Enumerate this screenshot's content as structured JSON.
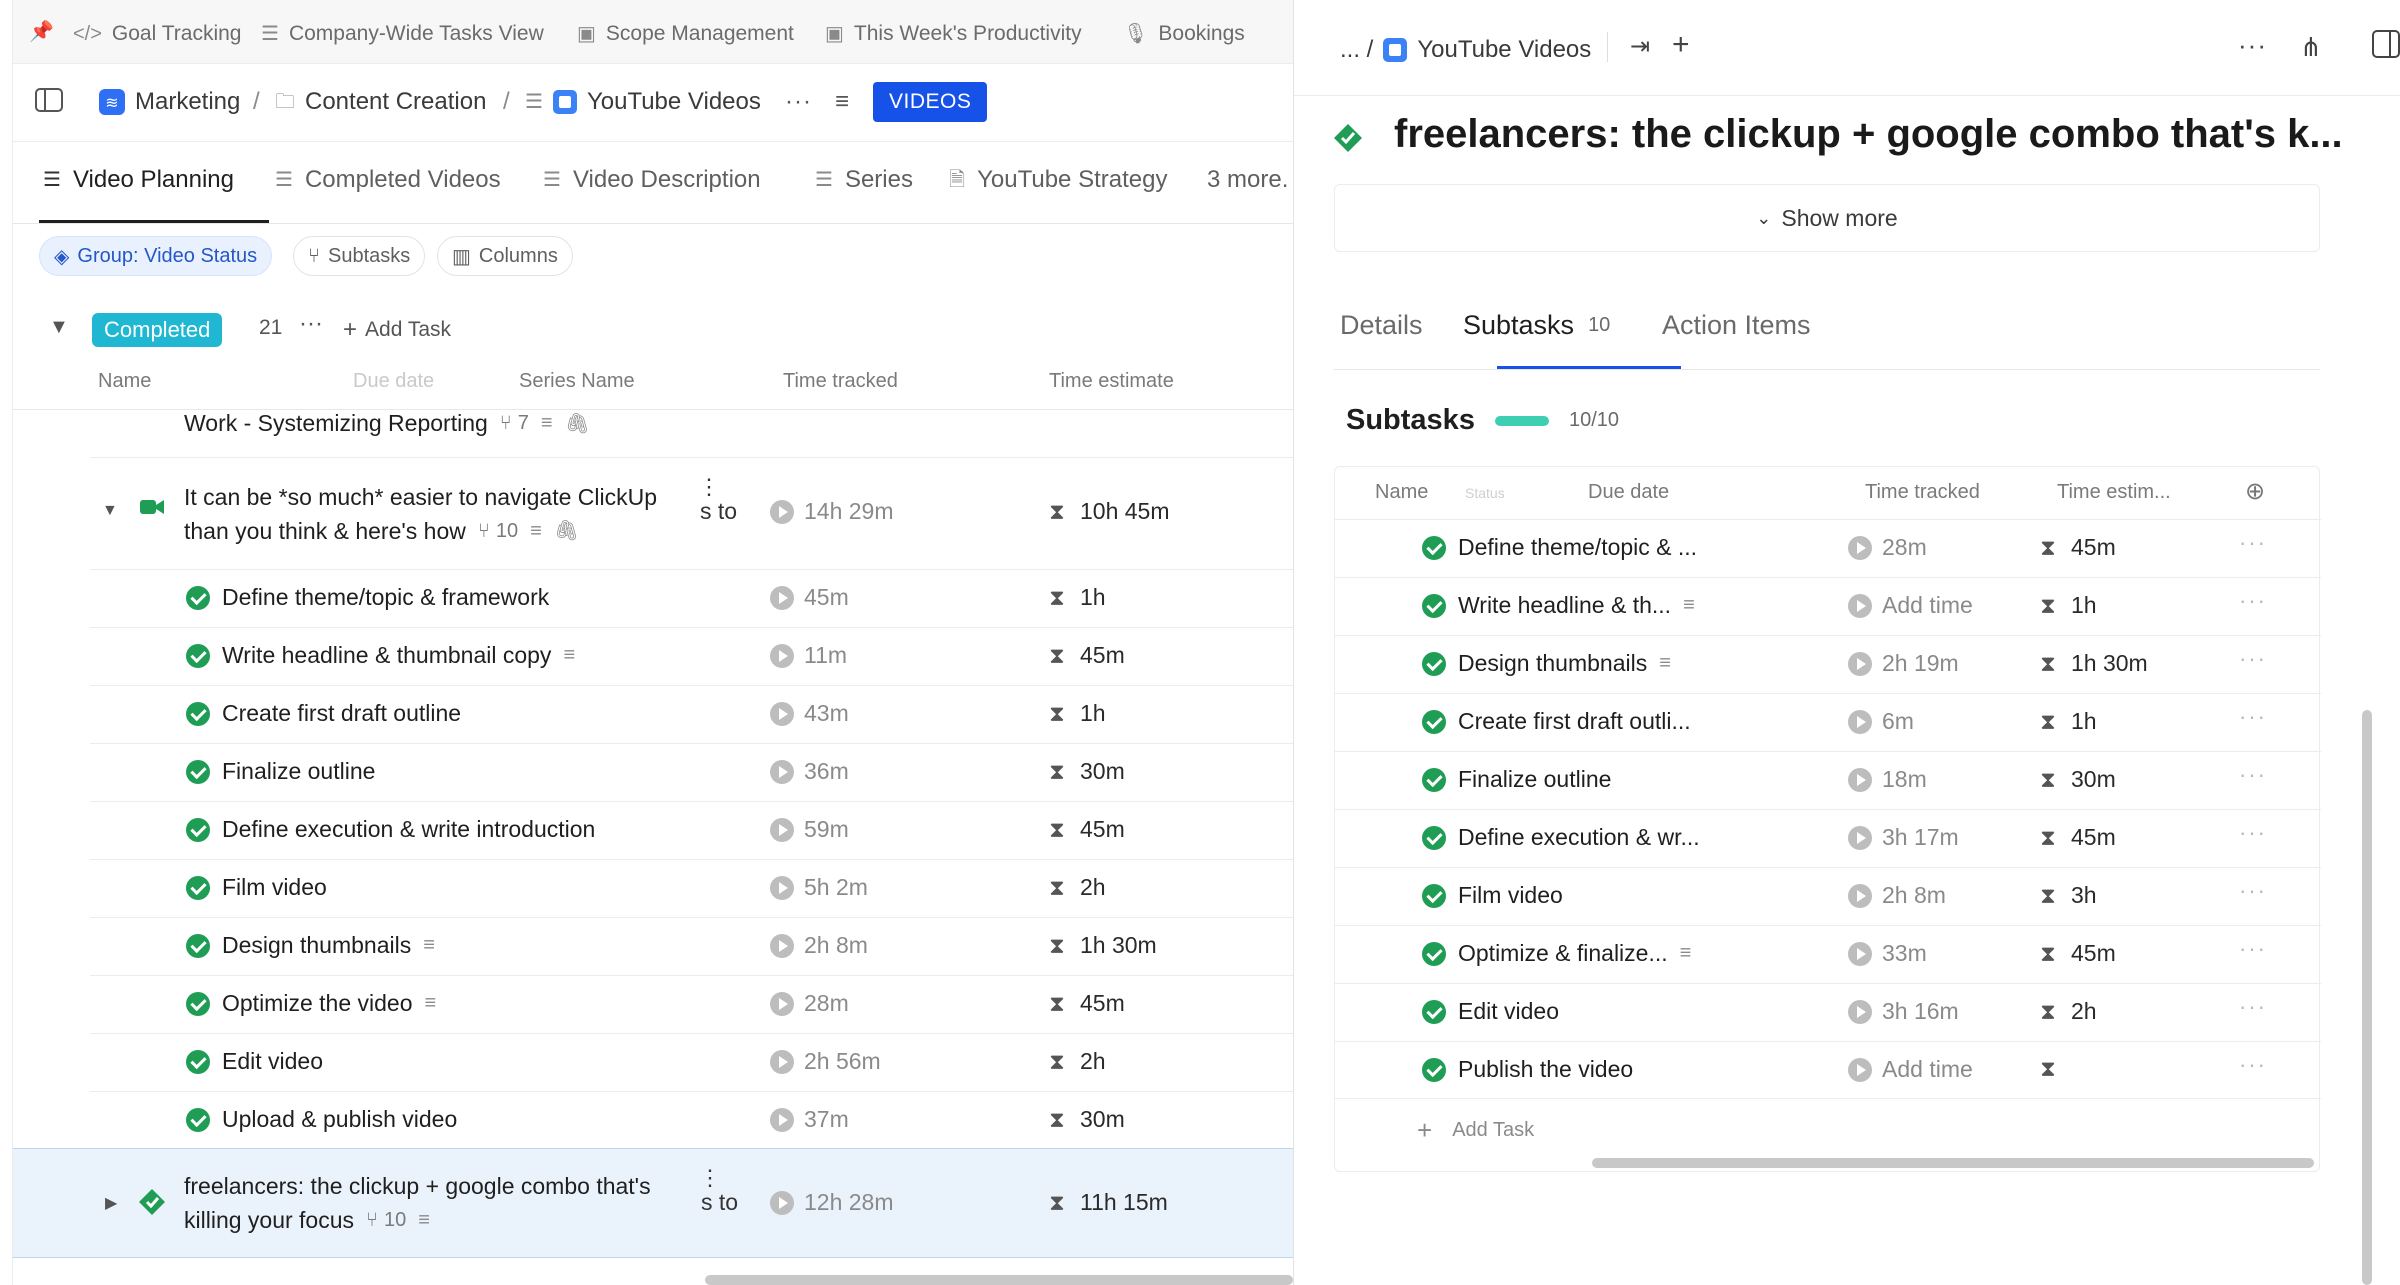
{
  "favorites": [
    {
      "icon": "pin-icon",
      "label": ""
    },
    {
      "icon": "code-icon",
      "label": "Goal Tracking"
    },
    {
      "icon": "checklist-icon",
      "label": "Company-Wide Tasks View"
    },
    {
      "icon": "dashboard-icon",
      "label": "Scope Management"
    },
    {
      "icon": "dashboard-icon",
      "label": "This Week's Productivity"
    },
    {
      "icon": "microphone-icon",
      "label": "Bookings"
    }
  ],
  "breadcrumb": {
    "space": "Marketing",
    "folder": "Content Creation",
    "list": "YouTube Videos",
    "badge": "VIDEOS"
  },
  "view_tabs": [
    {
      "label": "Video Planning",
      "active": true
    },
    {
      "label": "Completed Videos",
      "active": false
    },
    {
      "label": "Video Description",
      "active": false
    },
    {
      "label": "Series",
      "active": false
    },
    {
      "label": "YouTube Strategy",
      "active": false
    },
    {
      "label": "3 more.",
      "active": false
    }
  ],
  "filters": {
    "group": "Group: Video Status",
    "subtasks": "Subtasks",
    "columns": "Columns"
  },
  "group": {
    "status": "Completed",
    "count": "21",
    "add_task": "Add Task"
  },
  "columns": {
    "name": "Name",
    "due_date": "Due date",
    "series": "Series Name",
    "time_tracked": "Time tracked",
    "time_estimate": "Time estimate"
  },
  "partial_row": {
    "name": "Work - Systemizing Reporting",
    "subtasks": "7"
  },
  "parent_task": {
    "line1": "It can be *so much* easier to navigate ClickUp",
    "line2": "than you think & here's how",
    "subtasks": "10",
    "series_fragment": "s to",
    "tracked": "14h 29m",
    "estimate": "10h 45m"
  },
  "subtask_rows": [
    {
      "name": "Define theme/topic & framework",
      "desc": false,
      "tracked": "45m",
      "estimate": "1h"
    },
    {
      "name": "Write headline & thumbnail copy",
      "desc": true,
      "tracked": "11m",
      "estimate": "45m"
    },
    {
      "name": "Create first draft outline",
      "desc": false,
      "tracked": "43m",
      "estimate": "1h"
    },
    {
      "name": "Finalize outline",
      "desc": false,
      "tracked": "36m",
      "estimate": "30m"
    },
    {
      "name": "Define execution & write introduction",
      "desc": false,
      "tracked": "59m",
      "estimate": "45m"
    },
    {
      "name": "Film video",
      "desc": false,
      "tracked": "5h 2m",
      "estimate": "2h"
    },
    {
      "name": "Design thumbnails",
      "desc": true,
      "tracked": "2h 8m",
      "estimate": "1h 30m"
    },
    {
      "name": "Optimize the video",
      "desc": true,
      "tracked": "28m",
      "estimate": "45m"
    },
    {
      "name": "Edit video",
      "desc": false,
      "tracked": "2h 56m",
      "estimate": "2h"
    },
    {
      "name": "Upload & publish video",
      "desc": false,
      "tracked": "37m",
      "estimate": "30m"
    }
  ],
  "selected_task": {
    "line1": "freelancers: the clickup + google combo that's",
    "line2": "killing your focus",
    "subtasks": "10",
    "series_fragment": "s to",
    "tracked": "12h 28m",
    "estimate": "11h 15m"
  },
  "panel": {
    "crumb_prefix": "... /",
    "list": "YouTube Videos",
    "title": "freelancers: the clickup + google combo that's k...",
    "show_more": "Show more",
    "tabs": [
      {
        "label": "Details",
        "count": ""
      },
      {
        "label": "Subtasks",
        "count": "10"
      },
      {
        "label": "Action Items",
        "count": ""
      }
    ],
    "subtasks_heading": "Subtasks",
    "progress": "10/10",
    "progress_fraction": 1.0,
    "columns": {
      "name": "Name",
      "faint": "Status",
      "due_date": "Due date",
      "time_tracked": "Time tracked",
      "time_estimate": "Time estim..."
    },
    "rows": [
      {
        "name": "Define theme/topic & ...",
        "desc": false,
        "tracked": "28m",
        "estimate": "45m"
      },
      {
        "name": "Write headline & th...",
        "desc": true,
        "tracked": "Add time",
        "estimate": "1h"
      },
      {
        "name": "Design thumbnails",
        "desc": true,
        "tracked": "2h 19m",
        "estimate": "1h 30m"
      },
      {
        "name": "Create first draft outli...",
        "desc": false,
        "tracked": "6m",
        "estimate": "1h"
      },
      {
        "name": "Finalize outline",
        "desc": false,
        "tracked": "18m",
        "estimate": "30m"
      },
      {
        "name": "Define execution & wr...",
        "desc": false,
        "tracked": "3h 17m",
        "estimate": "45m"
      },
      {
        "name": "Film video",
        "desc": false,
        "tracked": "2h 8m",
        "estimate": "3h"
      },
      {
        "name": "Optimize & finalize...",
        "desc": true,
        "tracked": "33m",
        "estimate": "45m"
      },
      {
        "name": "Edit video",
        "desc": false,
        "tracked": "3h 16m",
        "estimate": "2h"
      },
      {
        "name": "Publish the video",
        "desc": false,
        "tracked": "Add time",
        "estimate": ""
      }
    ],
    "add_task": "Add Task"
  },
  "colors": {
    "accent": "#1652e8",
    "status_completed": "#1fb7d1",
    "check_green": "#1f9d55",
    "progress": "#3ecfb3",
    "selected_row": "#eaf3fc"
  }
}
